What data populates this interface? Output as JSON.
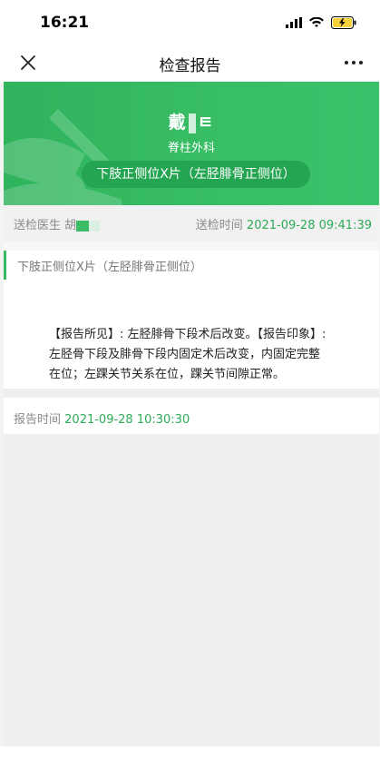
{
  "status_bar": {
    "time": "16:21"
  },
  "nav": {
    "title": "检查报告",
    "close_icon": "close-icon",
    "more_icon": "more-icon"
  },
  "header": {
    "patient_name_prefix": "戴",
    "patient_name_suffix": "ㅌ",
    "department": "脊柱外科",
    "exam_name": "下肢正侧位X片（左胫腓骨正侧位）"
  },
  "info": {
    "doctor_label": "送检医生",
    "doctor_name_prefix": "胡",
    "send_time_label": "送检时间",
    "send_time_value": "2021-09-28 09:41:39"
  },
  "exam_section": {
    "label": "下肢正侧位X片（左胫腓骨正侧位）"
  },
  "report": {
    "text": "【报告所见】: 左胫腓骨下段术后改变。【报告印象】: 左胫骨下段及腓骨下段内固定术后改变，内固定完整在位；左踝关节关系在位，踝关节间隙正常。"
  },
  "report_time": {
    "label": "报告时间",
    "value": "2021-09-28 10:30:30"
  },
  "colors": {
    "accent": "#2fb35d",
    "header_pill": "#24a552",
    "time_green": "#2eaa58"
  }
}
